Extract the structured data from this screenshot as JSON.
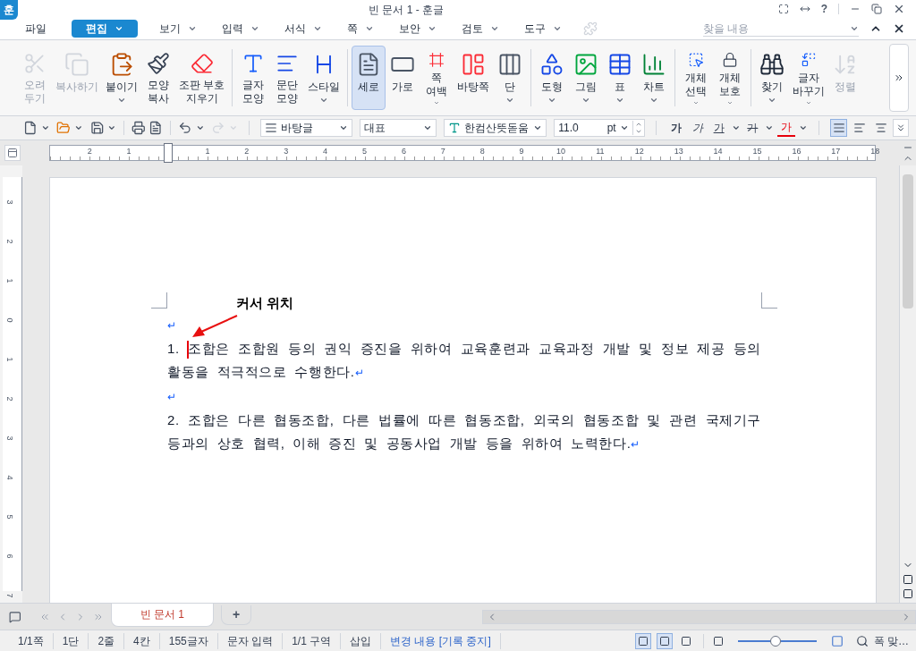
{
  "window": {
    "logo": "훈",
    "title": "빈 문서 1 - 훈글",
    "help": "?"
  },
  "menu": [
    {
      "label": "파일",
      "selected": false,
      "dropdown": false
    },
    {
      "label": "편집",
      "selected": true,
      "dropdown": true
    },
    {
      "label": "보기",
      "selected": false,
      "dropdown": true
    },
    {
      "label": "입력",
      "selected": false,
      "dropdown": true
    },
    {
      "label": "서식",
      "selected": false,
      "dropdown": true
    },
    {
      "label": "쪽",
      "selected": false,
      "dropdown": true
    },
    {
      "label": "보안",
      "selected": false,
      "dropdown": true
    },
    {
      "label": "검토",
      "selected": false,
      "dropdown": true
    },
    {
      "label": "도구",
      "selected": false,
      "dropdown": true
    }
  ],
  "search": {
    "placeholder": "찾을 내용"
  },
  "ribbon": [
    [
      {
        "lines": [
          "오려",
          "두기"
        ],
        "disabled": true,
        "selected": false,
        "dropdown": false
      },
      {
        "lines": [
          "복사하기"
        ],
        "disabled": true,
        "selected": false,
        "dropdown": false
      },
      {
        "lines": [
          "붙이기"
        ],
        "disabled": false,
        "selected": false,
        "dropdown": true
      },
      {
        "lines": [
          "모양",
          "복사"
        ],
        "disabled": false,
        "selected": false,
        "dropdown": false
      },
      {
        "lines": [
          "조판 부호",
          "지우기"
        ],
        "disabled": false,
        "selected": false,
        "dropdown": false
      }
    ],
    [
      {
        "lines": [
          "글자",
          "모양"
        ],
        "disabled": false,
        "selected": false,
        "dropdown": false
      },
      {
        "lines": [
          "문단",
          "모양"
        ],
        "disabled": false,
        "selected": false,
        "dropdown": false
      },
      {
        "lines": [
          "스타일"
        ],
        "disabled": false,
        "selected": false,
        "dropdown": true
      }
    ],
    [
      {
        "lines": [
          "세로"
        ],
        "disabled": false,
        "selected": true,
        "dropdown": false
      },
      {
        "lines": [
          "가로"
        ],
        "disabled": false,
        "selected": false,
        "dropdown": false
      },
      {
        "lines": [
          "쪽",
          "여백"
        ],
        "disabled": false,
        "selected": false,
        "dropdown": true
      },
      {
        "lines": [
          "바탕쪽"
        ],
        "disabled": false,
        "selected": false,
        "dropdown": false
      },
      {
        "lines": [
          "단"
        ],
        "disabled": false,
        "selected": false,
        "dropdown": true
      }
    ],
    [
      {
        "lines": [
          "도형"
        ],
        "disabled": false,
        "selected": false,
        "dropdown": true
      },
      {
        "lines": [
          "그림"
        ],
        "disabled": false,
        "selected": false,
        "dropdown": true
      },
      {
        "lines": [
          "표"
        ],
        "disabled": false,
        "selected": false,
        "dropdown": true
      },
      {
        "lines": [
          "차트"
        ],
        "disabled": false,
        "selected": false,
        "dropdown": true
      }
    ],
    [
      {
        "lines": [
          "개체",
          "선택"
        ],
        "disabled": false,
        "selected": false,
        "dropdown": true
      },
      {
        "lines": [
          "개체",
          "보호"
        ],
        "disabled": false,
        "selected": false,
        "dropdown": true
      }
    ],
    [
      {
        "lines": [
          "찾기"
        ],
        "disabled": false,
        "selected": false,
        "dropdown": true
      },
      {
        "lines": [
          "글자",
          "바꾸기"
        ],
        "disabled": false,
        "selected": false,
        "dropdown": true
      },
      {
        "lines": [
          "정렬"
        ],
        "disabled": true,
        "selected": false,
        "dropdown": false
      }
    ]
  ],
  "format_bar": {
    "style": "바탕글",
    "style_group": "대표",
    "font": "한컴산뜻돋움",
    "size": "11.0",
    "unit": "pt",
    "char_styles": [
      {
        "text": "가",
        "kind": "bold"
      },
      {
        "text": "가",
        "kind": "italic"
      },
      {
        "text": "가",
        "kind": "underline"
      },
      {
        "text": "가",
        "kind": "strike"
      },
      {
        "text": "가",
        "kind": "color"
      }
    ],
    "alignments": [
      {
        "selected": true
      },
      {
        "selected": false
      },
      {
        "selected": false
      }
    ]
  },
  "ruler": {
    "horizontal": [
      "2",
      "1",
      "1",
      "2",
      "3",
      "4",
      "5",
      "6",
      "7",
      "8",
      "9",
      "10",
      "11",
      "12",
      "13",
      "14",
      "15",
      "16",
      "17",
      "18"
    ],
    "vertical": [
      "3",
      "2",
      "1",
      "0",
      "1",
      "2",
      "3",
      "4",
      "5",
      "6",
      "7"
    ]
  },
  "document": {
    "annotation": "커서 위치",
    "paragraphs": [
      {
        "mark": "↵",
        "cursor": false
      },
      {
        "text": "1. 조합은 조합원 등의 권익 증진을 위하여 교육훈련과 교육과정 개발 및 정보 제공 등의 활동을 적극적으로 수행한다.",
        "mark": "↵",
        "cursor": true
      },
      {
        "mark": "↵",
        "cursor": false
      },
      {
        "text": "2. 조합은 다른 협동조합, 다른 법률에 따른 협동조합, 외국의 협동조합 및 관련 국제기구 등과의 상호 협력, 이해 증진 및 공동사업 개발 등을 위하여 노력한다.",
        "mark": "↵",
        "cursor": false
      }
    ]
  },
  "doc_tabs": [
    {
      "label": "빈 문서 1",
      "selected": true
    }
  ],
  "add_tab": "+",
  "status_bar": {
    "items": [
      "1/1쪽",
      "1단",
      "2줄",
      "4칸",
      "155글자",
      "문자 입력",
      "1/1 구역",
      "삽입"
    ],
    "track_changes": "변경 내용 [기록 중지]",
    "views": [
      {
        "selected": true
      },
      {
        "selected": true
      },
      {
        "selected": false
      }
    ],
    "zoom": {
      "level": 0.48,
      "label": "폭 맞…"
    }
  }
}
